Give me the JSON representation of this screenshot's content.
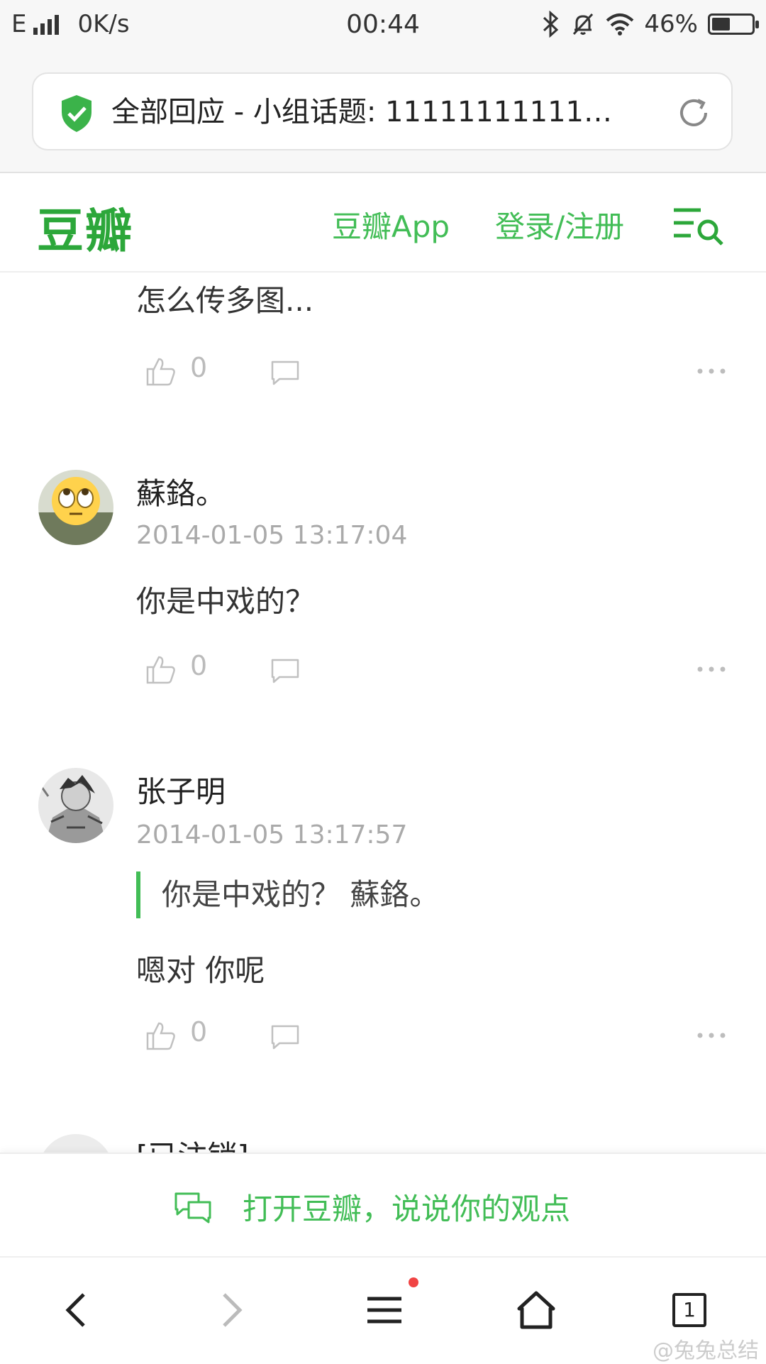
{
  "status_bar": {
    "network": "E",
    "speed": "0K/s",
    "time": "00:44",
    "battery": "46%",
    "battery_level": 0.46
  },
  "browser": {
    "page_title": "全部回应 - 小组话题: 11111111111111111"
  },
  "site": {
    "logo": "豆瓣",
    "app_link": "豆瓣App",
    "login_link": "登录/注册",
    "brand_color": "#42bd56"
  },
  "comments": [
    {
      "text": "怎么传多图...",
      "likes": "0"
    },
    {
      "author": "蘇鉻。",
      "time": "2014-01-05 13:17:04",
      "text": "你是中戏的？",
      "likes": "0"
    },
    {
      "author": "张子明",
      "time": "2014-01-05 13:17:57",
      "quote": "你是中戏的？ 蘇鉻。",
      "text": "嗯对 你呢",
      "likes": "0"
    },
    {
      "author": "[已注销]"
    }
  ],
  "open_app_bar": {
    "label": "打开豆瓣，说说你的观点"
  },
  "browser_nav": {
    "tab_count": "1"
  },
  "watermark": "@兔兔总结"
}
